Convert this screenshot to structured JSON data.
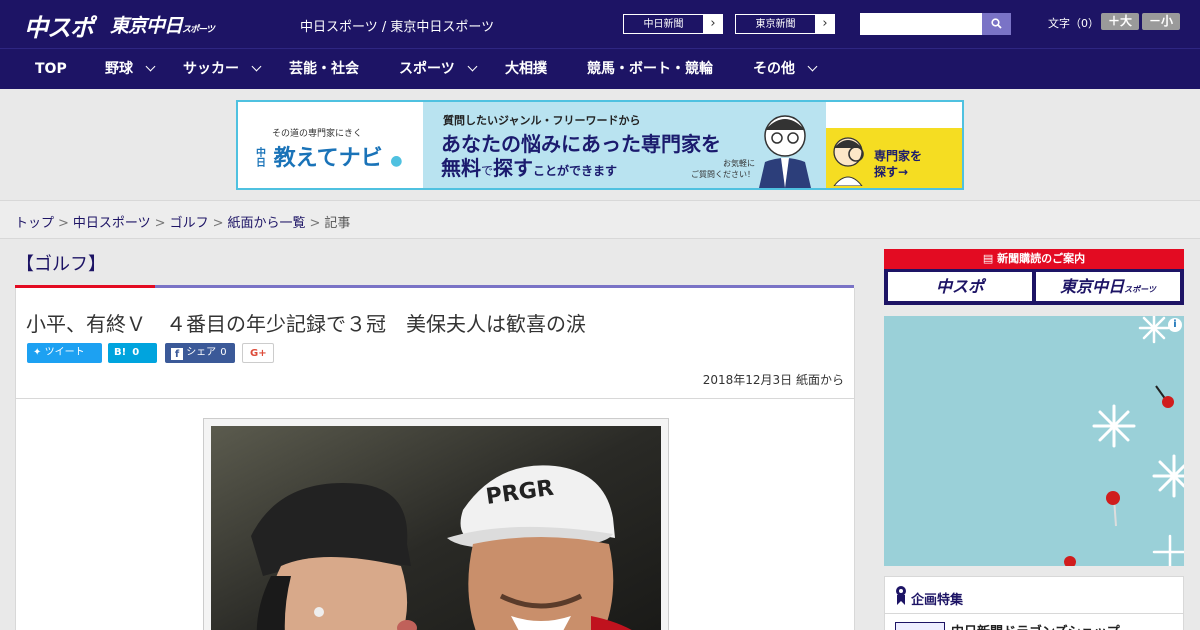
{
  "header": {
    "logo_chuspo": "中スポ",
    "logo_tokyo": "東京中日",
    "logo_tokyo_sub": "スポーツ",
    "site_links": "中日スポーツ / 東京中日スポーツ",
    "ext_links": [
      {
        "label": "中日新聞"
      },
      {
        "label": "東京新聞"
      }
    ],
    "search": {
      "placeholder": ""
    },
    "font_size_label": "文字（0）",
    "font_larger": "＋大",
    "font_smaller": "－小"
  },
  "nav": {
    "items": [
      {
        "label": "TOP",
        "has_dropdown": false
      },
      {
        "label": "野球",
        "has_dropdown": true
      },
      {
        "label": "サッカー",
        "has_dropdown": true
      },
      {
        "label": "芸能・社会",
        "has_dropdown": false
      },
      {
        "label": "スポーツ",
        "has_dropdown": true
      },
      {
        "label": "大相撲",
        "has_dropdown": false
      },
      {
        "label": "競馬・ボート・競輪",
        "has_dropdown": false
      },
      {
        "label": "その他",
        "has_dropdown": true
      }
    ]
  },
  "banner": {
    "small": "その道の専門家にきく",
    "logo": "教えてナビ",
    "logo_prefix": "中日",
    "question": "質問したいジャンル・フリーワードから",
    "line1": "あなたの悩みにあった専門家を",
    "line2_a": "無料",
    "line2_b": "で",
    "line2_c": "探す",
    "line2_d": "ことができます",
    "note1": "お気軽に",
    "note2": "ご質問ください！",
    "cta1": "専門家を",
    "cta2": "探す→"
  },
  "breadcrumb": {
    "items": [
      "トップ",
      "中日スポーツ",
      "ゴルフ",
      "紙面から一覧"
    ],
    "current": "記事",
    "separator": ">"
  },
  "category": {
    "label": "【ゴルフ】"
  },
  "article": {
    "title": "小平、有終Ｖ　４番目の年少記録で３冠　美保夫人は歓喜の涙",
    "share": {
      "tweet": "ツイート",
      "hatena": "B!",
      "hatena_count": "0",
      "facebook": "シェア",
      "facebook_count": "0",
      "gplus": "G+"
    },
    "date": "2018年12月3日 紙面から"
  },
  "sidebar": {
    "subscribe_head": "新聞購読のご案内",
    "sub_chuspo": "中スポ",
    "sub_tokyo": "東京中日",
    "sub_tokyo_small": "スポーツ",
    "ad_info": "i",
    "feature_title": "企画特集",
    "feature_item": "中日新聞ドラゴンズショップ"
  },
  "colors": {
    "brand_navy": "#1d1465",
    "accent_red": "#e30b22",
    "accent_purple": "#7a73c6",
    "banner_border": "#4fc1e0"
  }
}
